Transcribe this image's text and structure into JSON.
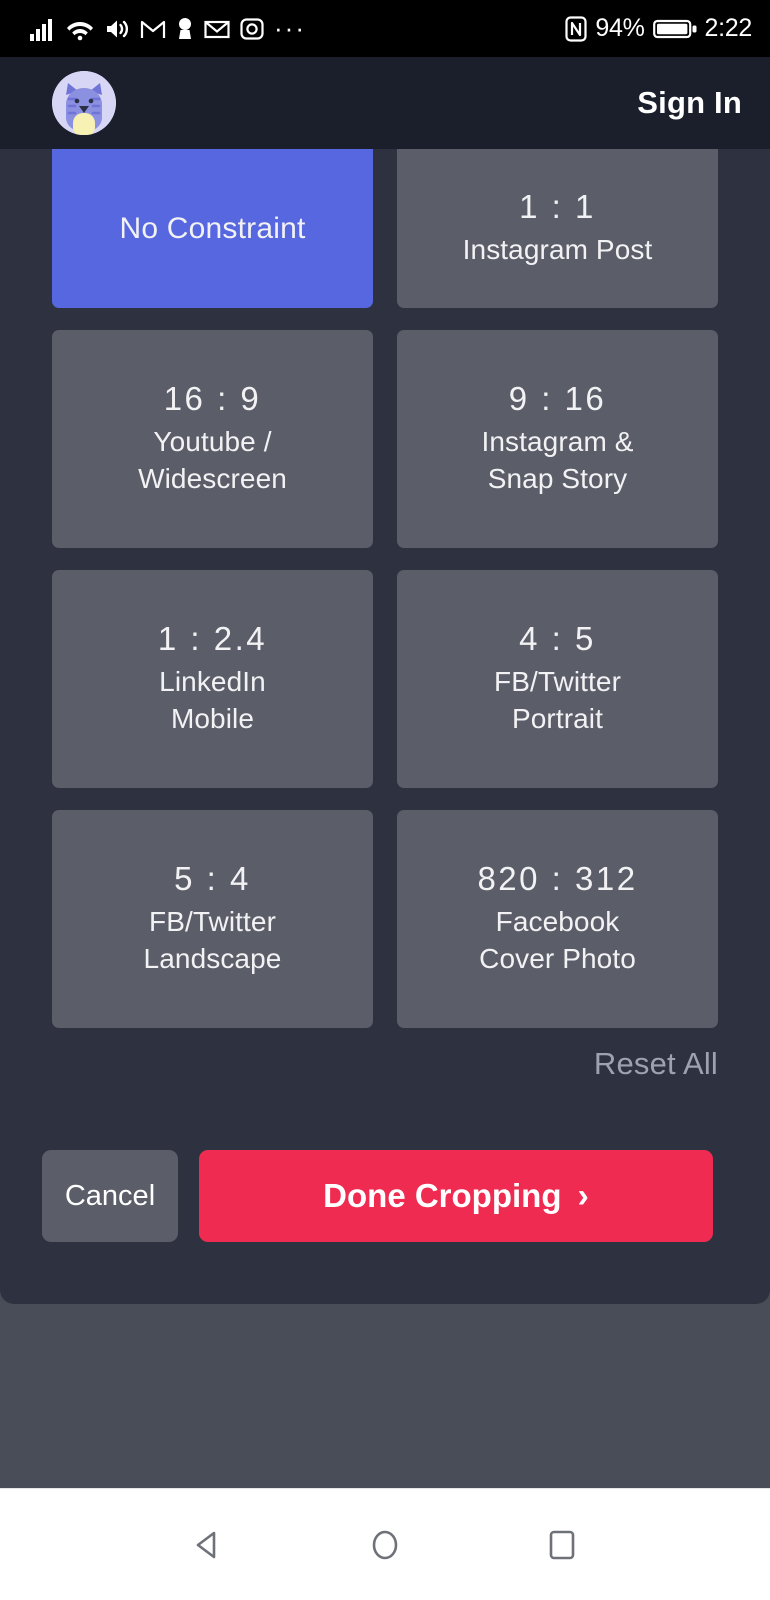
{
  "statusbar": {
    "icons_left": [
      "signal-bars-icon",
      "wifi-icon",
      "volume-icon",
      "gmail-icon",
      "keyhole-icon",
      "mail-icon",
      "instagram-icon",
      "overflow-dots-icon"
    ],
    "overflow": "···",
    "nfc_icon": "nfc-icon",
    "battery_percent": "94%",
    "battery_icon": "battery-icon",
    "clock": "2:22"
  },
  "header": {
    "avatar": "cat-avatar",
    "sign_in_label": "Sign In"
  },
  "crop_panel": {
    "tiles": [
      {
        "ratio": "",
        "caption": "No Constraint",
        "selected": true,
        "clipped": true
      },
      {
        "ratio": "1 : 1",
        "caption": "Instagram Post",
        "selected": false,
        "clipped": true
      },
      {
        "ratio": "16 : 9",
        "caption": "Youtube /\nWidescreen",
        "selected": false,
        "clipped": false
      },
      {
        "ratio": "9 : 16",
        "caption": "Instagram &\nSnap Story",
        "selected": false,
        "clipped": false
      },
      {
        "ratio": "1 : 2.4",
        "caption": "LinkedIn\nMobile",
        "selected": false,
        "clipped": false
      },
      {
        "ratio": "4 : 5",
        "caption": "FB/Twitter\nPortrait",
        "selected": false,
        "clipped": false
      },
      {
        "ratio": "5 : 4",
        "caption": "FB/Twitter\nLandscape",
        "selected": false,
        "clipped": false
      },
      {
        "ratio": "820 : 312",
        "caption": "Facebook\nCover Photo",
        "selected": false,
        "clipped": false
      }
    ],
    "reset_all_label": "Reset All",
    "cancel_label": "Cancel",
    "done_label": "Done Cropping",
    "done_chevron": "›"
  },
  "navbar": {
    "back": "back-triangle-icon",
    "home": "home-circle-icon",
    "recents": "recents-square-icon"
  },
  "colors": {
    "accent_selected": "#5767e0",
    "primary_action": "#ef2b51",
    "tile": "#5b5e69",
    "sheet": "#2e3240",
    "appbar": "#1b1f2b",
    "backdrop": "#494d58"
  }
}
